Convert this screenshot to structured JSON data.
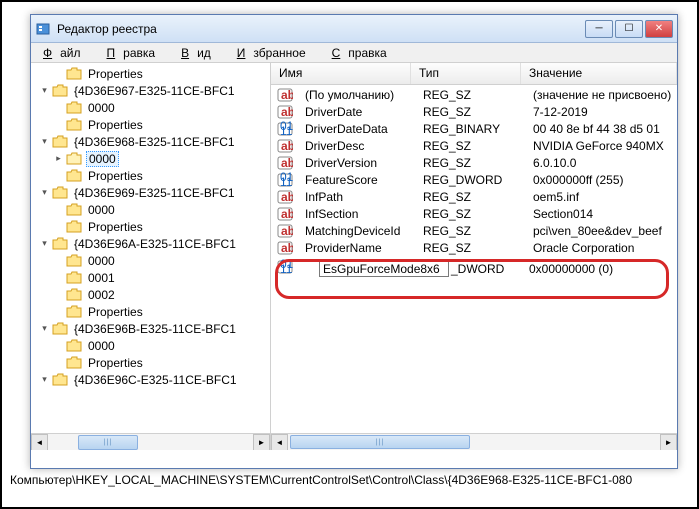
{
  "window": {
    "title": "Редактор реестра"
  },
  "menu": {
    "file": "Файл",
    "edit": "Правка",
    "view": "Вид",
    "favorites": "Избранное",
    "help": "Справка"
  },
  "tree": [
    {
      "indent": 1,
      "twisty": "",
      "label": "Properties",
      "sel": false
    },
    {
      "indent": 0,
      "twisty": "▾",
      "label": "{4D36E967-E325-11CE-BFC1",
      "sel": false
    },
    {
      "indent": 1,
      "twisty": "",
      "label": "0000",
      "sel": false
    },
    {
      "indent": 1,
      "twisty": "",
      "label": "Properties",
      "sel": false
    },
    {
      "indent": 0,
      "twisty": "▾",
      "label": "{4D36E968-E325-11CE-BFC1",
      "sel": false
    },
    {
      "indent": 1,
      "twisty": "▸",
      "label": "0000",
      "sel": true,
      "open": true
    },
    {
      "indent": 1,
      "twisty": "",
      "label": "Properties",
      "sel": false
    },
    {
      "indent": 0,
      "twisty": "▾",
      "label": "{4D36E969-E325-11CE-BFC1",
      "sel": false
    },
    {
      "indent": 1,
      "twisty": "",
      "label": "0000",
      "sel": false
    },
    {
      "indent": 1,
      "twisty": "",
      "label": "Properties",
      "sel": false
    },
    {
      "indent": 0,
      "twisty": "▾",
      "label": "{4D36E96A-E325-11CE-BFC1",
      "sel": false
    },
    {
      "indent": 1,
      "twisty": "",
      "label": "0000",
      "sel": false
    },
    {
      "indent": 1,
      "twisty": "",
      "label": "0001",
      "sel": false
    },
    {
      "indent": 1,
      "twisty": "",
      "label": "0002",
      "sel": false
    },
    {
      "indent": 1,
      "twisty": "",
      "label": "Properties",
      "sel": false
    },
    {
      "indent": 0,
      "twisty": "▾",
      "label": "{4D36E96B-E325-11CE-BFC1",
      "sel": false
    },
    {
      "indent": 1,
      "twisty": "",
      "label": "0000",
      "sel": false
    },
    {
      "indent": 1,
      "twisty": "",
      "label": "Properties",
      "sel": false
    },
    {
      "indent": 0,
      "twisty": "▾",
      "label": "{4D36E96C-E325-11CE-BFC1",
      "sel": false
    }
  ],
  "columns": {
    "name": "Имя",
    "type": "Тип",
    "value": "Значение"
  },
  "rows": [
    {
      "icon": "str",
      "name": "(По умолчанию)",
      "type": "REG_SZ",
      "value": "(значение не присвоено)"
    },
    {
      "icon": "str",
      "name": "DriverDate",
      "type": "REG_SZ",
      "value": "7-12-2019"
    },
    {
      "icon": "bin",
      "name": "DriverDateData",
      "type": "REG_BINARY",
      "value": "00 40 8e bf 44 38 d5 01"
    },
    {
      "icon": "str",
      "name": "DriverDesc",
      "type": "REG_SZ",
      "value": "NVIDIA GeForce 940MX"
    },
    {
      "icon": "str",
      "name": "DriverVersion",
      "type": "REG_SZ",
      "value": "6.0.10.0"
    },
    {
      "icon": "bin",
      "name": "FeatureScore",
      "type": "REG_DWORD",
      "value": "0x000000ff (255)"
    },
    {
      "icon": "str",
      "name": "InfPath",
      "type": "REG_SZ",
      "value": "oem5.inf"
    },
    {
      "icon": "str",
      "name": "InfSection",
      "type": "REG_SZ",
      "value": "Section014"
    },
    {
      "icon": "str",
      "name": "MatchingDeviceId",
      "type": "REG_SZ",
      "value": "pci\\ven_80ee&dev_beef"
    },
    {
      "icon": "str",
      "name": "ProviderName",
      "type": "REG_SZ",
      "value": "Oracle Corporation"
    }
  ],
  "edit": {
    "icon": "bin",
    "value": "EsGpuForceMode8x6",
    "type_suffix": "_DWORD",
    "data": "0x00000000 (0)"
  },
  "status": "Компьютер\\HKEY_LOCAL_MACHINE\\SYSTEM\\CurrentControlSet\\Control\\Class\\{4D36E968-E325-11CE-BFC1-080"
}
